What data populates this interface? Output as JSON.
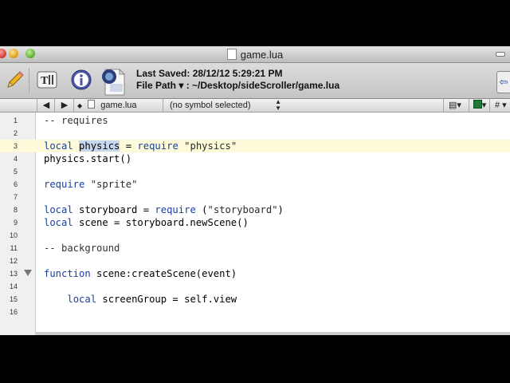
{
  "window": {
    "title": "game.lua"
  },
  "toolbar": {
    "last_saved_label": "Last Saved:",
    "last_saved_value": "28/12/12 5:29:21 PM",
    "file_path_label": "File Path ▾ :",
    "file_path_value": "~/Desktop/sideScroller/game.lua"
  },
  "navbar": {
    "back": "◀",
    "forward": "▶",
    "file": "game.lua",
    "symbol": "(no symbol selected)",
    "hash": "#"
  },
  "editor": {
    "lines": [
      {
        "n": "1",
        "t": "-- requires"
      },
      {
        "n": "2",
        "t": ""
      },
      {
        "n": "3",
        "t": "local physics = require \"physics\""
      },
      {
        "n": "4",
        "t": "physics.start()"
      },
      {
        "n": "5",
        "t": ""
      },
      {
        "n": "6",
        "t": "require \"sprite\""
      },
      {
        "n": "7",
        "t": ""
      },
      {
        "n": "8",
        "t": "local storyboard = require (\"storyboard\")"
      },
      {
        "n": "9",
        "t": "local scene = storyboard.newScene()"
      },
      {
        "n": "10",
        "t": ""
      },
      {
        "n": "11",
        "t": "-- background"
      },
      {
        "n": "12",
        "t": ""
      },
      {
        "n": "13",
        "t": "function scene:createScene(event)"
      },
      {
        "n": "14",
        "t": ""
      },
      {
        "n": "15",
        "t": "    local screenGroup = self.view"
      },
      {
        "n": "16",
        "t": ""
      }
    ]
  }
}
